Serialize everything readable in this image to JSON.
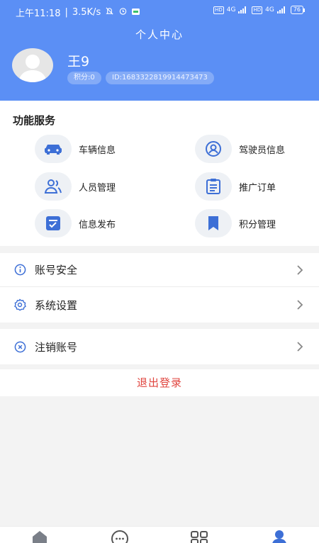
{
  "status_bar": {
    "time": "上午11:18",
    "speed": "3.5K/s",
    "sig1_label": "4G",
    "sig2_label": "4G",
    "hd1": "HD",
    "hd2": "HD",
    "battery": "76"
  },
  "header": {
    "title": "个人中心",
    "username": "王9",
    "points": "积分:0",
    "user_id": "ID:1683322819914473473"
  },
  "functions": {
    "title": "功能服务",
    "items": [
      {
        "label": "车辆信息",
        "icon": "car-icon"
      },
      {
        "label": "驾驶员信息",
        "icon": "driver-icon"
      },
      {
        "label": "人员管理",
        "icon": "people-icon"
      },
      {
        "label": "推广订单",
        "icon": "order-icon"
      },
      {
        "label": "信息发布",
        "icon": "publish-icon"
      },
      {
        "label": "积分管理",
        "icon": "bookmark-icon"
      }
    ]
  },
  "menu": {
    "account_security": "账号安全",
    "system_settings": "系统设置",
    "cancel_account": "注销账号",
    "logout": "退出登录"
  },
  "colors": {
    "header_bg": "#5b8ff5",
    "accent": "#3d6fd6",
    "logout": "#e0453f"
  }
}
